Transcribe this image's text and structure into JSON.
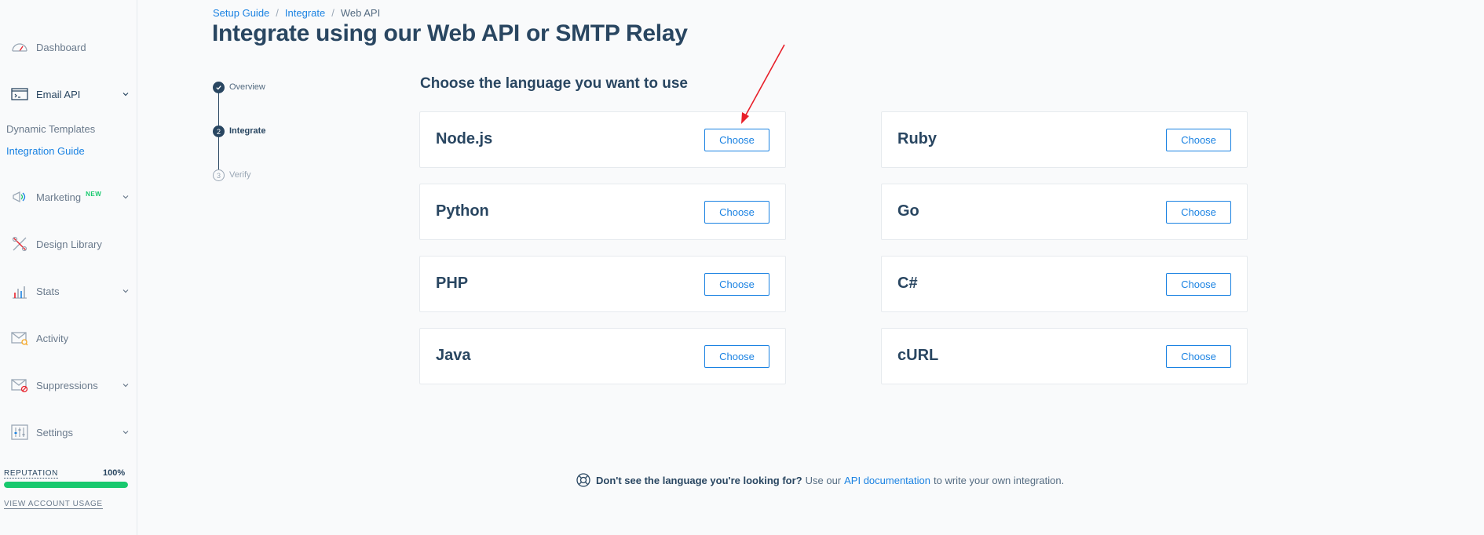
{
  "sidebar": {
    "items": [
      {
        "label": "Dashboard",
        "icon": "speedometer-icon"
      },
      {
        "label": "Email API",
        "icon": "email-api-icon"
      },
      {
        "label": "Marketing",
        "badge": "NEW",
        "icon": "megaphone-icon"
      },
      {
        "label": "Design Library",
        "icon": "design-tools-icon"
      },
      {
        "label": "Stats",
        "icon": "bar-chart-icon"
      },
      {
        "label": "Activity",
        "icon": "envelope-search-icon"
      },
      {
        "label": "Suppressions",
        "icon": "envelope-block-icon"
      },
      {
        "label": "Settings",
        "icon": "sliders-icon"
      }
    ],
    "email_api_sub": {
      "dynamic_templates": "Dynamic Templates",
      "integration_guide": "Integration Guide"
    },
    "reputation": {
      "label": "REPUTATION",
      "value": "100%",
      "percent": 100
    },
    "view_usage": "VIEW ACCOUNT USAGE"
  },
  "breadcrumb": {
    "setup_guide": "Setup Guide",
    "integrate": "Integrate",
    "current": "Web API"
  },
  "page_title": "Integrate using our Web API or SMTP Relay",
  "steps": [
    {
      "label": "Overview",
      "state": "done"
    },
    {
      "label": "Integrate",
      "number": "2",
      "state": "current"
    },
    {
      "label": "Verify",
      "number": "3",
      "state": "pending"
    }
  ],
  "section_title": "Choose the language you want to use",
  "languages": {
    "left": [
      {
        "name": "Node.js",
        "button": "Choose"
      },
      {
        "name": "Python",
        "button": "Choose"
      },
      {
        "name": "PHP",
        "button": "Choose"
      },
      {
        "name": "Java",
        "button": "Choose"
      }
    ],
    "right": [
      {
        "name": "Ruby",
        "button": "Choose"
      },
      {
        "name": "Go",
        "button": "Choose"
      },
      {
        "name": "C#",
        "button": "Choose"
      },
      {
        "name": "cURL",
        "button": "Choose"
      }
    ]
  },
  "footer": {
    "bold": "Don't see the language you're looking for?",
    "pre": "Use our",
    "link": "API documentation",
    "post": "to write your own integration."
  },
  "colors": {
    "accent": "#1a82e2",
    "text": "#294661",
    "success": "#18c96e",
    "annotation": "#e8202a"
  }
}
